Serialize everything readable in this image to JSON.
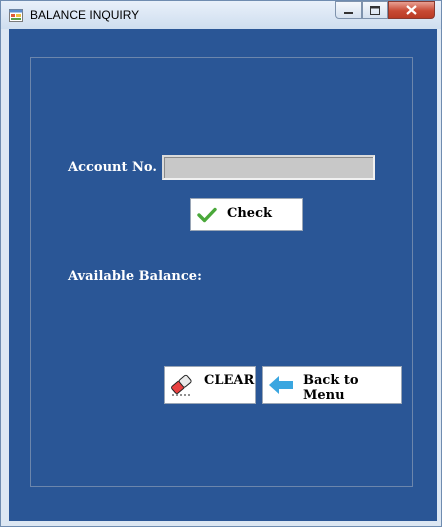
{
  "window": {
    "title": "BALANCE INQUIRY"
  },
  "form": {
    "account_label": "Account No.",
    "account_value": "",
    "check_label": "Check",
    "balance_label": "Available Balance:",
    "clear_label": "CLEAR",
    "back_label": "Back to Menu"
  },
  "colors": {
    "client_bg": "#2a5696",
    "input_bg": "#c8c8c8"
  },
  "icons": {
    "app": "app-form-icon",
    "check": "checkmark-icon",
    "clear": "eraser-icon",
    "back": "arrow-left-icon"
  }
}
